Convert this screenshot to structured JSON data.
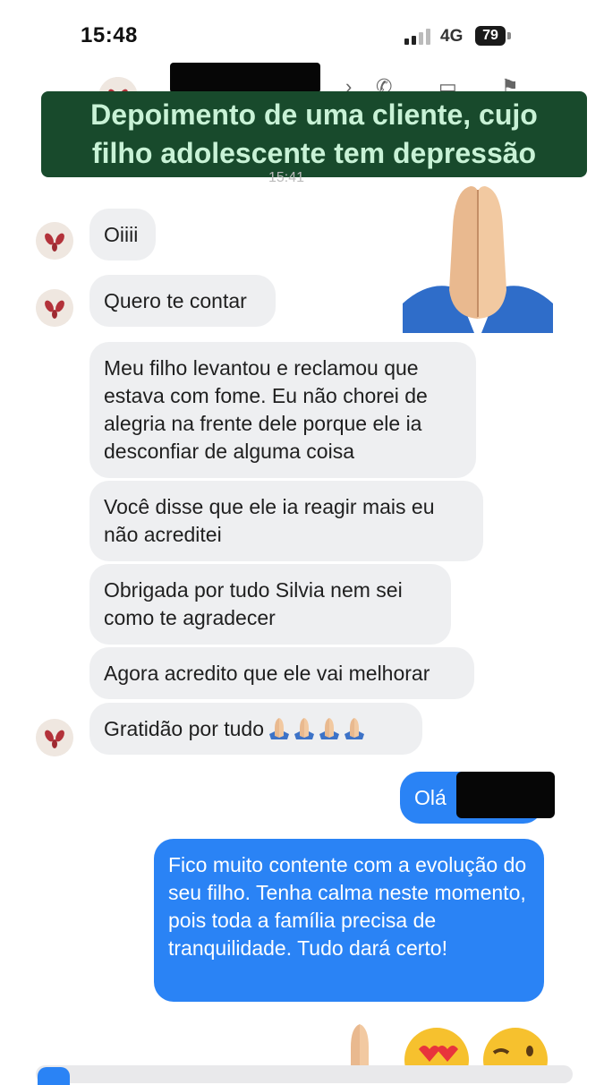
{
  "status": {
    "time": "15:48",
    "network": "4G",
    "battery": "79"
  },
  "banner": {
    "line1": "Depoimento de uma cliente, cujo",
    "line2": "filho adolescente tem depressão"
  },
  "thread": {
    "timestamp": "15:41"
  },
  "incoming": [
    "Oiiii",
    "Quero te contar",
    "Meu filho levantou e reclamou que estava com fome. Eu não chorei de alegria na frente dele porque ele ia desconfiar de alguma coisa",
    "Você disse que ele ia reagir mais eu não acreditei",
    "Obrigada por tudo Silvia nem sei como te agradecer",
    "Agora acredito que ele vai melhorar",
    "Gratidão por tudo"
  ],
  "outgoing": [
    "Olá",
    "Fico muito contente com a evolução do seu filho. Tenha calma neste momento, pois toda a família precisa de tranquilidade. Tudo dará certo!"
  ],
  "icons": {
    "sticker": "praying-hands",
    "inline_emoji": "praying-hands x4",
    "reactions": [
      "praying-hands",
      "heart-eyes-face",
      "winking-face"
    ]
  },
  "colors": {
    "banner_bg": "#184a2c",
    "banner_text": "#c8f2d6",
    "bubble_in": "#eeeff1",
    "bubble_out": "#2a83f5"
  }
}
